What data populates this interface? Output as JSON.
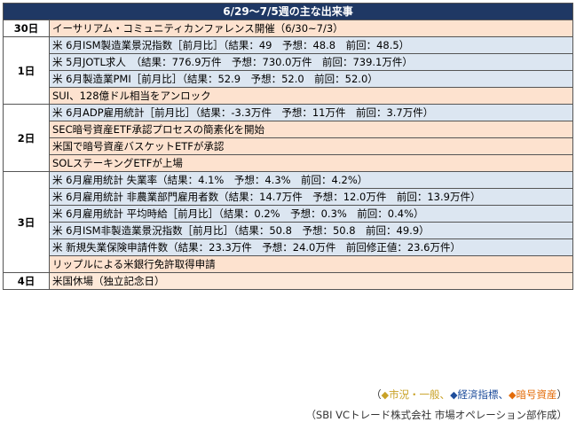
{
  "title": "6/29〜7/5週の主な出来事",
  "days": {
    "d30": "30日",
    "d1": "1日",
    "d2": "2日",
    "d3": "3日",
    "d4": "4日"
  },
  "events": {
    "e30_1": "イーサリアム・コミュニティカンファレンス開催（6/30~7/3）",
    "e1_1": "米 6月ISM製造業景況指数［前月比］（結果：49　予想：48.8　前回：48.5）",
    "e1_2": "米 5月JOTL求人　（結果：776.9万件　予想：730.0万件　前回：739.1万件）",
    "e1_3": "米 6月製造業PMI［前月比］（結果：52.9　予想：52.0　前回：52.0）",
    "e1_4": "SUI、128億ドル相当をアンロック",
    "e2_1": "米 6月ADP雇用統計［前月比］（結果：-3.3万件　予想：11万件　前回：3.7万件）",
    "e2_2": "SEC暗号資産ETF承認プロセスの簡素化を開始",
    "e2_3": "米国で暗号資産バスケットETFが承認",
    "e2_4": "SOLステーキングETFが上場",
    "e3_1": "米 6月雇用統計 失業率（結果：4.1%　予想：4.3%　前回：4.2%）",
    "e3_2": "米 6月雇用統計 非農業部門雇用者数（結果：14.7万件　予想：12.0万件　前回：13.9万件）",
    "e3_3": "米 6月雇用統計 平均時給［前月比］（結果：0.2%　予想：0.3%　前回：0.4%）",
    "e3_4": "米 6月ISM非製造業景況指数［前月比］（結果：50.8　予想：50.8　前回：49.9）",
    "e3_5": "米 新規失業保険申請件数（結果：23.3万件　予想：24.0万件　前回修正値：23.6万件）",
    "e3_6": "リップルによる米銀行免許取得申請",
    "e4_1": "米国休場（独立記念日）"
  },
  "legend": {
    "open": "（",
    "market": "市況・一般、",
    "indicator": "経済指標、",
    "crypto": "暗号資産",
    "close": "）"
  },
  "credit": "（SBI VCトレード株式会社 市場オペレーション部作成）",
  "colors": {
    "header_bg": "#1f3864",
    "market": "#fde9d9",
    "indicator": "#dce6f1",
    "crypto": "#fde2cf",
    "legend_market": "#c9a227",
    "legend_indicator": "#1f4e9c",
    "legend_crypto": "#e36c09"
  }
}
